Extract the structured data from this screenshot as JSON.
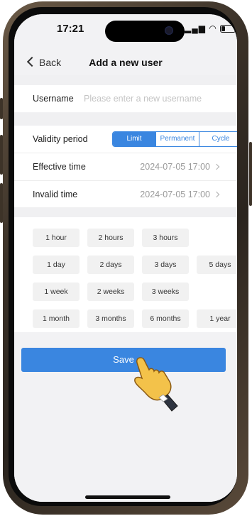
{
  "status_bar": {
    "time": "17:21",
    "icons": [
      "signal-icon",
      "wifi-icon",
      "battery-icon"
    ]
  },
  "nav": {
    "back_label": "Back",
    "title": "Add a new user"
  },
  "username": {
    "label": "Username",
    "placeholder": "Please enter a new username"
  },
  "validity": {
    "label": "Validity period",
    "options": [
      "Limit",
      "Permanent",
      "Cycle"
    ],
    "selected": "Limit"
  },
  "effective_time": {
    "label": "Effective time",
    "value": "2024-07-05 17:00"
  },
  "invalid_time": {
    "label": "Invalid time",
    "value": "2024-07-05 17:00"
  },
  "durations": [
    [
      "1 hour",
      "2 hours",
      "3 hours"
    ],
    [
      "1 day",
      "2 days",
      "3 days",
      "5 days"
    ],
    [
      "1 week",
      "2 weeks",
      "3 weeks"
    ],
    [
      "1 month",
      "3 months",
      "6 months",
      "1 year"
    ]
  ],
  "save_label": "Save",
  "colors": {
    "accent": "#3a86e0",
    "background": "#f2f2f4"
  }
}
